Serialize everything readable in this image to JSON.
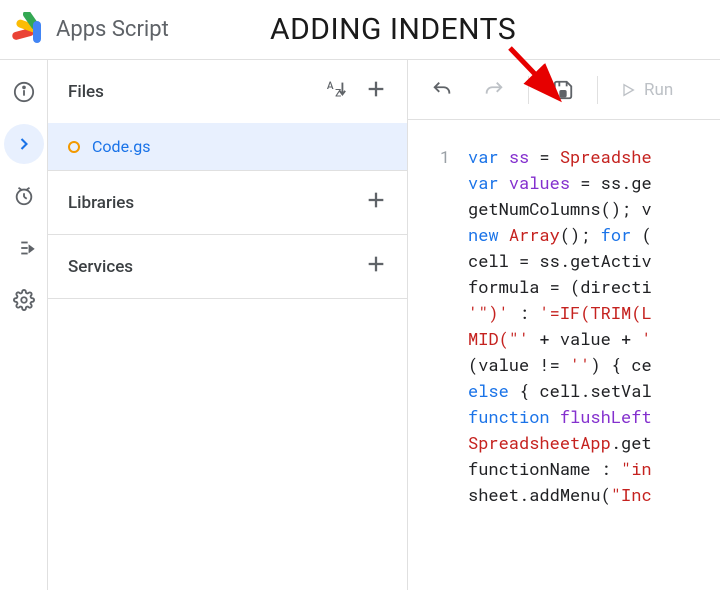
{
  "header": {
    "app_title": "Apps Script",
    "annotation": "ADDING INDENTS"
  },
  "files_panel": {
    "files_label": "Files",
    "file_name": "Code.gs",
    "libraries_label": "Libraries",
    "services_label": "Services"
  },
  "toolbar": {
    "run_label": "Run"
  },
  "editor": {
    "line_number": "1",
    "code_tokens": [
      [
        {
          "t": "var ",
          "c": "kw"
        },
        {
          "t": "ss",
          "c": "id"
        },
        {
          "t": " = "
        },
        {
          "t": "Spreadshe",
          "c": "cls"
        }
      ],
      [
        {
          "t": "var ",
          "c": "kw"
        },
        {
          "t": "values",
          "c": "id"
        },
        {
          "t": " = "
        },
        {
          "t": "ss",
          "c": ""
        },
        {
          "t": ".ge"
        }
      ],
      [
        {
          "t": "getNumColumns",
          "c": ""
        },
        {
          "t": "(); "
        },
        {
          "t": "v",
          "c": ""
        }
      ],
      [
        {
          "t": "new ",
          "c": "kw"
        },
        {
          "t": "Array",
          "c": "cls"
        },
        {
          "t": "(); "
        },
        {
          "t": "for ",
          "c": "kw"
        },
        {
          "t": "("
        }
      ],
      [
        {
          "t": "cell",
          "c": ""
        },
        {
          "t": " = "
        },
        {
          "t": "ss",
          "c": ""
        },
        {
          "t": ".getActiv"
        }
      ],
      [
        {
          "t": "formula",
          "c": ""
        },
        {
          "t": " = ("
        },
        {
          "t": "directi",
          "c": ""
        }
      ],
      [
        {
          "t": "'\")'",
          "c": "str"
        },
        {
          "t": " : "
        },
        {
          "t": "'=IF(TRIM(L",
          "c": "str"
        }
      ],
      [
        {
          "t": "MID(\"'",
          "c": "str"
        },
        {
          "t": " + "
        },
        {
          "t": "value",
          "c": ""
        },
        {
          "t": " + "
        },
        {
          "t": "'",
          "c": "str"
        }
      ],
      [
        {
          "t": "("
        },
        {
          "t": "value",
          "c": ""
        },
        {
          "t": " != "
        },
        {
          "t": "''",
          "c": "str"
        },
        {
          "t": ") { "
        },
        {
          "t": "ce",
          "c": ""
        }
      ],
      [
        {
          "t": "else ",
          "c": "kw"
        },
        {
          "t": "{ "
        },
        {
          "t": "cell",
          "c": ""
        },
        {
          "t": ".setVal"
        }
      ],
      [
        {
          "t": "function ",
          "c": "kw"
        },
        {
          "t": "flushLeft",
          "c": "id"
        }
      ],
      [
        {
          "t": "SpreadsheetApp",
          "c": "cls"
        },
        {
          "t": ".get"
        }
      ],
      [
        {
          "t": "functionName",
          "c": ""
        },
        {
          "t": " : "
        },
        {
          "t": "\"in",
          "c": "str"
        }
      ],
      [
        {
          "t": "sheet",
          "c": ""
        },
        {
          "t": ".addMenu("
        },
        {
          "t": "\"Inc",
          "c": "str"
        }
      ]
    ]
  }
}
